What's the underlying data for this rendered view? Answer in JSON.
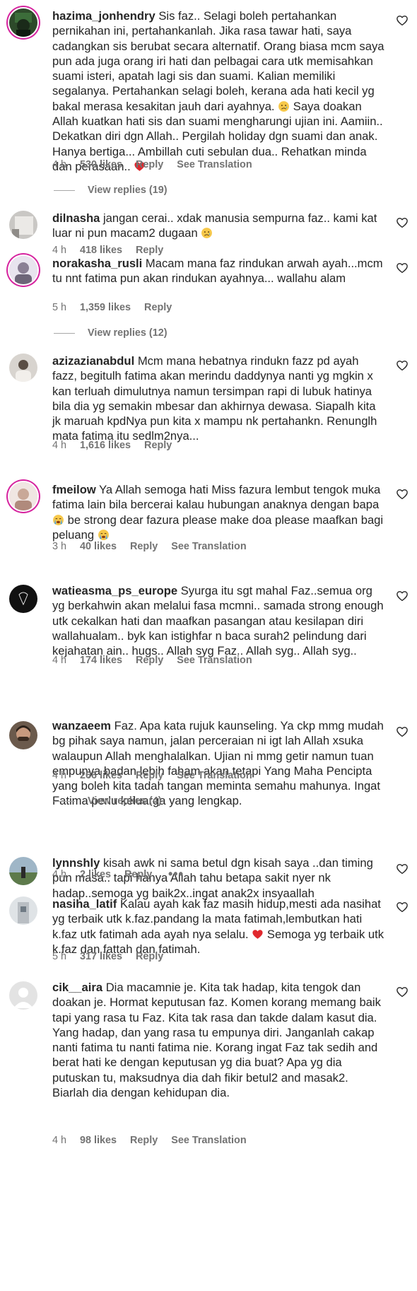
{
  "comments": [
    {
      "username": "hazima_jonhendry",
      "text": "Sis faz.. Selagi boleh pertahankan pernikahan ini, pertahankanlah. Jika rasa tawar hati, saya cadangkan sis berubat secara alternatif. Orang biasa mcm saya pun ada juga orang iri hati dan pelbagai cara utk memisahkan suami isteri, apatah lagi sis dan suami. Kalian memiliki segalanya. Pertahankan selagi boleh, kerana ada hati kecil yg bakal merasa kesakitan jauh dari ayahnya.",
      "text_tail": "Saya doakan Allah kuatkan hati sis dan suami mengharungi ujian ini. Aamiin.. Dekatkan diri dgn Allah.. Pergilah holiday dgn suami dan anak. Hanya bertiga... Ambillah cuti sebulan dua.. Rehatkan minda dan perasaan..",
      "time": "4 h",
      "likes": "530 likes",
      "reply": "Reply",
      "translation": "See Translation",
      "view_replies": "View replies (19)"
    },
    {
      "username": "dilnasha",
      "text": "jangan cerai.. xdak manusia sempurna faz.. kami kat luar ni pun macam2 dugaan",
      "time": "4 h",
      "likes": "418 likes",
      "reply": "Reply"
    },
    {
      "username": "norakasha_rusli",
      "text": "Macam mana faz rindukan arwah ayah...mcm tu nnt fatima pun akan rindukan ayahnya... wallahu alam",
      "time": "5 h",
      "likes": "1,359 likes",
      "reply": "Reply",
      "view_replies": "View replies (12)"
    },
    {
      "username": "azizazianabdul",
      "text": "Mcm mana hebatnya rindukn fazz pd ayah fazz, begitulh fatima akan merindu daddynya nanti yg mgkin x kan terluah dimulutnya namun tersimpan rapi di lubuk hatinya bila dia yg semakin mbesar dan akhirnya dewasa. Siapalh kita jk maruah kpdNya pun kita x mampu nk pertahankn. Renunglh mata fatima itu sedlm2nya...",
      "time": "4 h",
      "likes": "1,616 likes",
      "reply": "Reply"
    },
    {
      "username": "fmeilow",
      "text_a": "Ya Allah semoga hati Miss fazura lembut tengok muka fatima lain bila bercerai kalau hubungan anaknya dengan bapa",
      "text_b": "be strong dear fazura please make doa please maafkan bagi peluang",
      "time": "3 h",
      "likes": "40 likes",
      "reply": "Reply",
      "translation": "See Translation"
    },
    {
      "username": "watieasma_ps_europe",
      "text": "Syurga itu sgt mahal Faz..semua org yg berkahwin akan melalui fasa mcmni.. samada strong enough utk cekalkan hati dan maafkan pasangan atau kesilapan diri wallahualam.. byk kan istighfar n baca surah2 pelindung dari kejahatan ain.. hugs.. Allah syg Faz.. Allah syg.. Allah syg..",
      "time": "4 h",
      "likes": "174 likes",
      "reply": "Reply",
      "translation": "See Translation"
    },
    {
      "username": "wanzaeem",
      "text": "Faz. Apa kata rujuk kaunseling. Ya ckp mmg mudah bg pihak saya namun, jalan perceraian ni igt lah Allah xsuka walaupun Allah menghalalkan. Ujian ni mmg getir namun tuan empunya badan lebih faham akan tetapi Yang Maha Pencipta yang boleh kita tadah tangan meminta semahu mahunya. Ingat Fatima perlu keluarga yang lengkap.",
      "time": "4 h",
      "likes": "266 likes",
      "reply": "Reply",
      "translation": "See Translation",
      "view_replies": "View replies (4)"
    },
    {
      "username": "lynnshly",
      "text": "kisah awk ni sama betul dgn kisah saya ..dan timing pun masa.. tapi hanya Allah tahu betapa sakit nyer nk hadap..semoga yg baik2x..ingat anak2x insyaallah",
      "time": "4 h",
      "likes": "2 likes",
      "reply": "Reply",
      "more": "•••"
    },
    {
      "username": "nasiha_latif",
      "text": "Kalau ayah kak faz masih hidup,mesti ada nasihat yg terbaik utk k.faz.pandang la mata fatimah,lembutkan hati k.faz utk fatimah ada ayah nya selalu.",
      "text_tail": "Semoga yg terbaik utk k.faz dan fattah dan fatimah.",
      "time": "5 h",
      "likes": "317 likes",
      "reply": "Reply"
    },
    {
      "username": "cik__aira",
      "text": "Dia macamnie je. Kita tak hadap, kita tengok dan doakan je. Hormat keputusan faz. Komen korang memang baik tapi yang rasa tu Faz. Kita tak rasa dan takde dalam kasut dia. Yang hadap, dan yang rasa tu empunya diri. Janganlah cakap nanti fatima tu nanti fatima nie. Korang ingat Faz tak sedih and berat hati ke dengan keputusan yg dia buat? Apa yg dia putuskan tu, maksudnya dia dah fikir betul2 and masak2. Biarlah dia dengan kehidupan dia.",
      "time": "4 h",
      "likes": "98 likes",
      "reply": "Reply",
      "translation": "See Translation"
    }
  ],
  "icons": {
    "heart": "heart-outline-icon",
    "emoji_sad": "sad-face-emoji",
    "emoji_cry": "crying-face-emoji",
    "emoji_heart": "red-heart-emoji"
  },
  "colors": {
    "text": "#262626",
    "meta": "#737373",
    "emoji_heart": "#e0282e",
    "emoji_face": "#f7c84a"
  }
}
